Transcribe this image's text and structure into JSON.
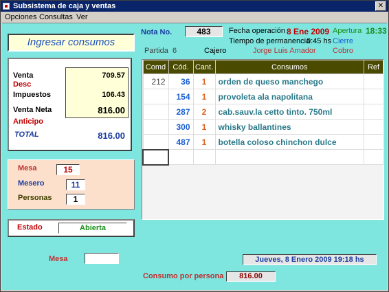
{
  "window": {
    "title": "Subsistema de caja y ventas",
    "close_label": "✕"
  },
  "menu": [
    "Opciones",
    "Consultas",
    "Ver"
  ],
  "heading": "Ingresar consumos",
  "header": {
    "nota_label": "Nota No.",
    "nota_value": "483",
    "fecha_label": "Fecha operación",
    "fecha_value": "8 Ene 2009",
    "apertura_label": "Apertura",
    "apertura_value": "18:33",
    "permanencia_label": "Tiempo de permanencia",
    "permanencia_value": "0:45 hs",
    "cierre_label": "Cierre",
    "partida_label": "Partida",
    "partida_value": "6",
    "cajero_label": "Cajero",
    "cajero_value": "Jorge Luis Amador",
    "cobro_label": "Cobro"
  },
  "totals": {
    "venta_label": "Venta",
    "venta_value": "709.57",
    "desc_label": "Desc",
    "impuestos_label": "Impuestos",
    "impuestos_value": "106.43",
    "venta_neta_label": "Venta Neta",
    "venta_neta_value": "816.00",
    "anticipo_label": "Anticipo",
    "total_label": "TOTAL",
    "total_value": "816.00"
  },
  "mesa_panel": {
    "mesa_label": "Mesa",
    "mesa_value": "15",
    "mesero_label": "Mesero",
    "mesero_value": "11",
    "personas_label": "Personas",
    "personas_value": "1"
  },
  "estado": {
    "label": "Estado",
    "value": "Abierta"
  },
  "grid": {
    "columns": [
      "Comd",
      "Cód.",
      "Cant.",
      "Consumos",
      "Ref"
    ],
    "rows": [
      {
        "comd": "212",
        "cod": "36",
        "cant": "1",
        "consumo": "orden de queso manchego"
      },
      {
        "comd": "",
        "cod": "154",
        "cant": "1",
        "consumo": "provoleta ala napolitana"
      },
      {
        "comd": "",
        "cod": "287",
        "cant": "2",
        "consumo": "cab.sauv.la cetto tinto. 750ml"
      },
      {
        "comd": "",
        "cod": "300",
        "cant": "1",
        "consumo": "whisky ballantines"
      },
      {
        "comd": "",
        "cod": "487",
        "cant": "1",
        "consumo": "botella coloso chinchon dulce"
      }
    ]
  },
  "footer": {
    "mesa_label": "Mesa",
    "datetime": "Jueves,  8  Enero  2009   19:18  hs",
    "cpp_label": "Consumo por persona",
    "cpp_value": "816.00"
  },
  "colors": {
    "client_bg": "#7fe5df",
    "title_bar": "#0a246a",
    "grid_header": "#4a4a00"
  }
}
